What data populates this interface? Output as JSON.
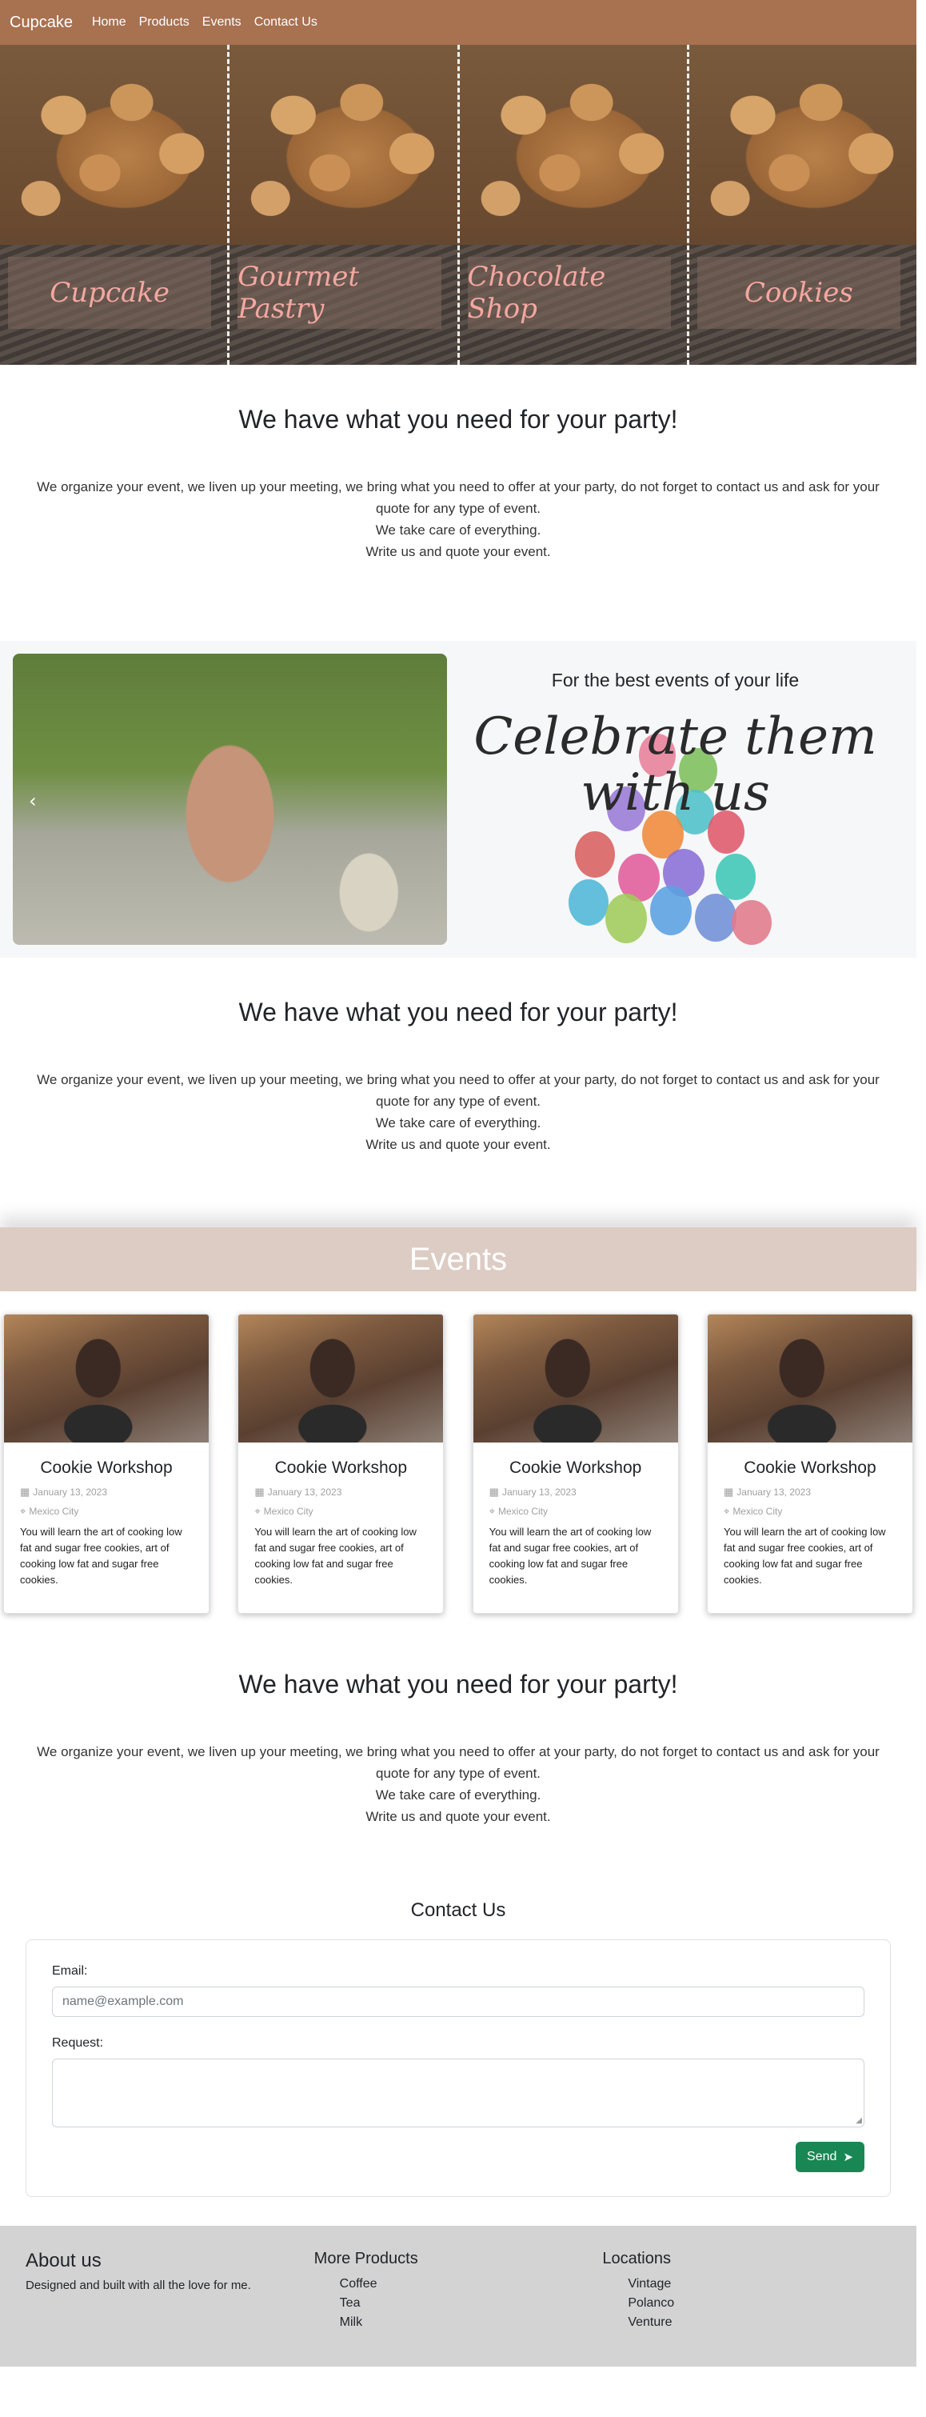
{
  "navbar": {
    "brand": "Cupcake",
    "links": [
      "Home",
      "Products",
      "Events",
      "Contact Us"
    ]
  },
  "hero": {
    "panels": [
      "Cupcake",
      "Gourmet Pastry",
      "Chocolate Shop",
      "Cookies"
    ]
  },
  "intro": {
    "title": "We have what you need for your party!",
    "line1": "We organize your event, we liven up your meeting, we bring what you need to offer at your party, do not forget to contact us and ask for your quote for any type of event.",
    "line2": "We take care of everything.",
    "line3": "Write us and quote your event."
  },
  "celebrate": {
    "subtitle": "For the best events of your life",
    "headline": "Celebrate them with us"
  },
  "events": {
    "title": "Events",
    "cards": [
      {
        "title": "Cookie Workshop",
        "date": "January 13, 2023",
        "location": "Mexico City",
        "text": "You will learn the art of cooking low fat and sugar free cookies, art of cooking low fat and sugar free cookies."
      },
      {
        "title": "Cookie Workshop",
        "date": "January 13, 2023",
        "location": "Mexico City",
        "text": "You will learn the art of cooking low fat and sugar free cookies, art of cooking low fat and sugar free cookies."
      },
      {
        "title": "Cookie Workshop",
        "date": "January 13, 2023",
        "location": "Mexico City",
        "text": "You will learn the art of cooking low fat and sugar free cookies, art of cooking low fat and sugar free cookies."
      },
      {
        "title": "Cookie Workshop",
        "date": "January 13, 2023",
        "location": "Mexico City",
        "text": "You will learn the art of cooking low fat and sugar free cookies, art of cooking low fat and sugar free cookies."
      }
    ]
  },
  "contact": {
    "title": "Contact Us",
    "email_label": "Email:",
    "email_placeholder": "name@example.com",
    "request_label": "Request:",
    "send_label": "Send"
  },
  "footer": {
    "about_title": "About us",
    "about_text": "Designed and built with all the love for me.",
    "products_title": "More Products",
    "products": [
      "Coffee",
      "Tea",
      "Milk"
    ],
    "locations_title": "Locations",
    "locations": [
      "Vintage",
      "Polanco",
      "Venture"
    ]
  },
  "icons": {
    "calendar": "calendar-icon",
    "location": "map-pin-icon",
    "send": "paper-plane-icon"
  },
  "colors": {
    "navbar": "#a87150",
    "events_banner": "#ddccc4",
    "send_button": "#198754",
    "footer": "#d3d3d3"
  }
}
